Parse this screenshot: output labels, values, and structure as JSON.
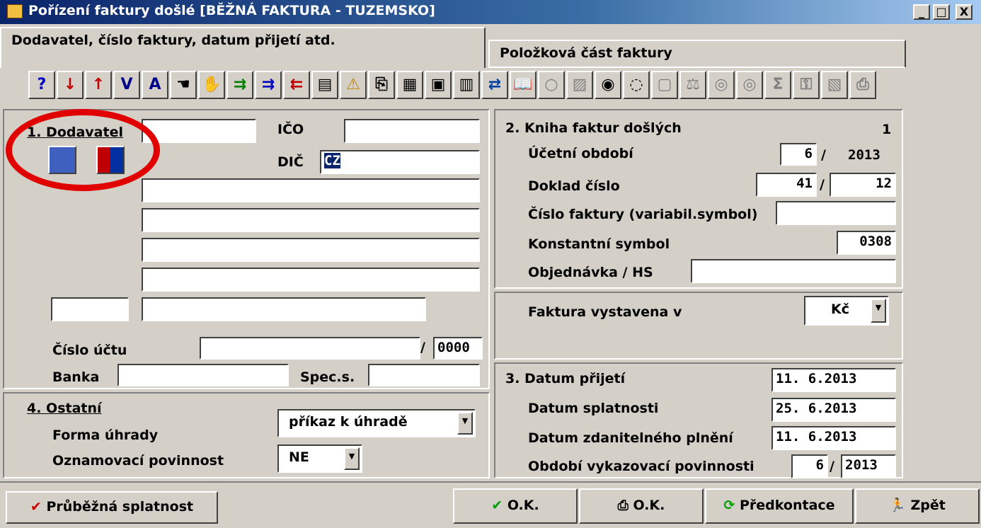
{
  "window": {
    "title": "Pořízení faktury došlé [BĚŽNÁ FAKTURA - TUZEMSKO]",
    "min": "_",
    "max": "□",
    "close": "X"
  },
  "tabs": [
    "Dodavatel, číslo faktury, datum přijetí atd.",
    "Položková část faktury"
  ],
  "toolbar": {
    "help": "?",
    "down": "↓",
    "up": "↑",
    "first": "V",
    "last": "A"
  },
  "supplier": {
    "heading": "1. Dodavatel",
    "ico_label": "IČO",
    "dic_label": "DIČ",
    "dic_value": "CZ",
    "account_label": "Číslo účtu",
    "account_sep": "/",
    "bank_code": "0000",
    "bank_label": "Banka",
    "spec_label": "Spec.s."
  },
  "book": {
    "heading": "2. Kniha faktur došlých",
    "book_no": "1",
    "period_label": "Účetní období",
    "period_month": "6",
    "period_sep": "/",
    "period_year": "2013",
    "doc_label": "Doklad číslo",
    "doc_no": "41",
    "doc_sep": "/",
    "doc_series": "12",
    "invoice_label": "Číslo faktury (variabil.symbol)",
    "const_label": "Konstantní symbol",
    "const_value": "0308",
    "order_label": "Objednávka / HS"
  },
  "currency": {
    "label": "Faktura vystavena v",
    "value": "Kč"
  },
  "dates": {
    "heading": "3. Datum přijetí",
    "received": "11. 6.2013",
    "due_label": "Datum splatnosti",
    "due": "25. 6.2013",
    "tax_label": "Datum zdanitelného plnění",
    "tax": "11. 6.2013",
    "report_label": "Období vykazovací povinnosti",
    "report_month": "6",
    "report_sep": "/",
    "report_year": "2013"
  },
  "other": {
    "heading": "4. Ostatní",
    "payment_label": "Forma úhrady",
    "payment_value": "příkaz k úhradě",
    "notify_label": "Oznamovací povinnost",
    "notify_value": "NE"
  },
  "buttons": {
    "running_due": "Průběžná splatnost",
    "ok": "O.K.",
    "print_ok": "O.K.",
    "precontace": "Předkontace",
    "back": "Zpět"
  },
  "colors": {
    "title_start": "#0a246a",
    "highlight_circle": "#e00000",
    "selection": "#0a246a"
  }
}
